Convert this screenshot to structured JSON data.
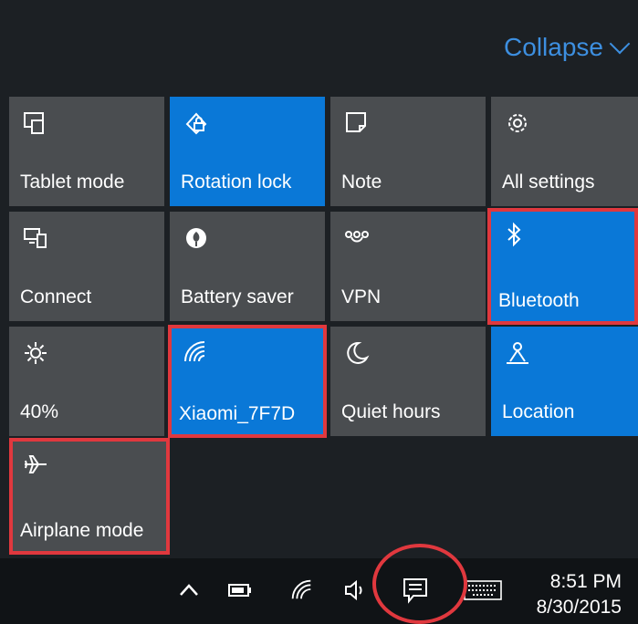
{
  "header": {
    "collapse_label": "Collapse"
  },
  "tiles": [
    {
      "label": "Tablet mode",
      "icon": "tablet-mode-icon",
      "on": false
    },
    {
      "label": "Rotation lock",
      "icon": "rotation-lock-icon",
      "on": true
    },
    {
      "label": "Note",
      "icon": "note-icon",
      "on": false
    },
    {
      "label": "All settings",
      "icon": "gear-icon",
      "on": false
    },
    {
      "label": "Connect",
      "icon": "connect-icon",
      "on": false
    },
    {
      "label": "Battery saver",
      "icon": "battery-saver-icon",
      "on": false
    },
    {
      "label": "VPN",
      "icon": "vpn-icon",
      "on": false
    },
    {
      "label": "Bluetooth",
      "icon": "bluetooth-icon",
      "on": true
    },
    {
      "label": "40%",
      "icon": "brightness-icon",
      "on": false
    },
    {
      "label": "Xiaomi_7F7D",
      "icon": "wifi-icon",
      "on": true
    },
    {
      "label": "Quiet hours",
      "icon": "moon-icon",
      "on": false
    },
    {
      "label": "Location",
      "icon": "location-icon",
      "on": true
    },
    {
      "label": "Airplane mode",
      "icon": "airplane-icon",
      "on": false
    }
  ],
  "taskbar": {
    "time": "8:51 PM",
    "date": "8/30/2015",
    "icons": [
      "chevron-up-icon",
      "battery-icon",
      "wifi-icon",
      "volume-icon",
      "action-center-icon",
      "keyboard-icon"
    ]
  },
  "colors": {
    "tile_on": "#0a78d7",
    "tile_off": "#4a4d50",
    "highlight": "#e0383e",
    "accent_text": "#3d8fe0"
  }
}
